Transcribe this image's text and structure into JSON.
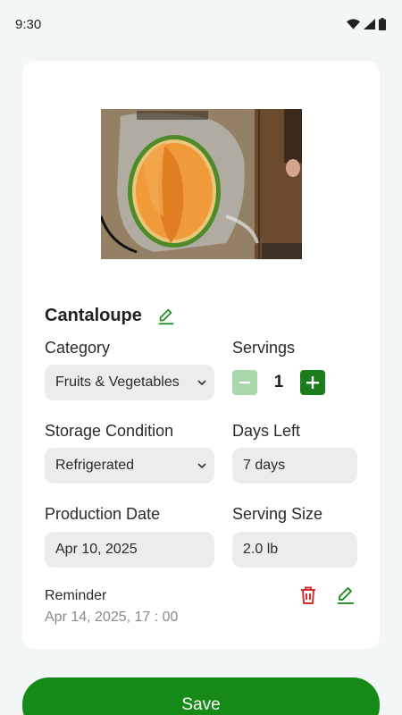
{
  "status_bar": {
    "time": "9:30"
  },
  "food": {
    "name": "Cantaloupe",
    "image_alt": "Cantaloupe half in a plastic bag"
  },
  "fields": {
    "category_label": "Category",
    "category_value": "Fruits & Vegetables",
    "servings_label": "Servings",
    "servings_value": "1",
    "storage_label": "Storage Condition",
    "storage_value": "Refrigerated",
    "days_left_label": "Days Left",
    "days_left_value": "7 days",
    "production_date_label": "Production Date",
    "production_date_value": "Apr 10, 2025",
    "serving_size_label": "Serving Size",
    "serving_size_value": "2.0 lb"
  },
  "reminder": {
    "title": "Reminder",
    "time": "Apr 14, 2025, 17 : 00"
  },
  "actions": {
    "save_label": "Save"
  },
  "colors": {
    "primary_green": "#168a16",
    "light_green": "#a9d9aa",
    "delete_red": "#d32f2f",
    "field_bg": "#ececec"
  },
  "icons": {
    "status": [
      "wifi-icon",
      "signal-icon",
      "battery-icon"
    ],
    "edit": "pencil-icon",
    "delete": "trash-icon",
    "dropdown": "chevron-down-icon"
  }
}
